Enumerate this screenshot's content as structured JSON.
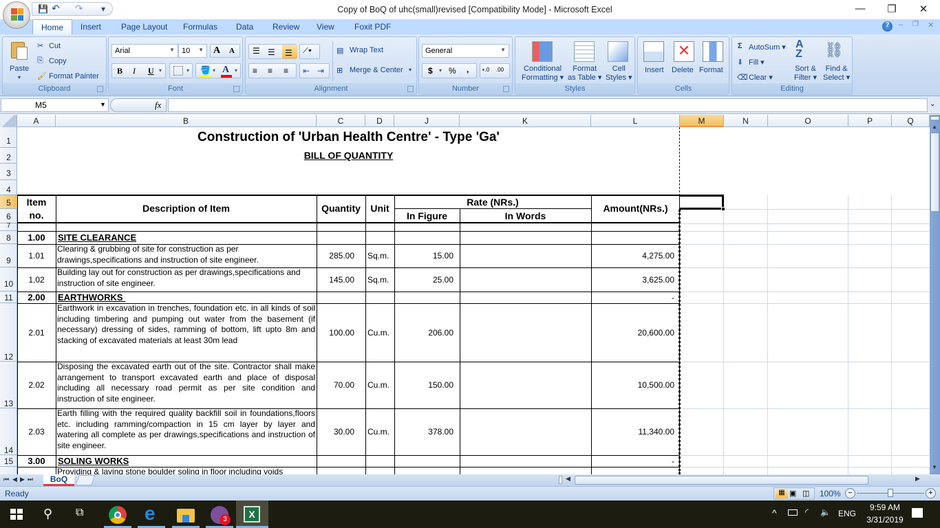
{
  "window": {
    "title": "Copy of BoQ of uhc(small)revised  [Compatibility Mode] - Microsoft Excel",
    "minimize": "—",
    "restore": "❐",
    "close": "✕"
  },
  "qat": {
    "save": "💾",
    "undo": "↶",
    "redo": "↷",
    "customize": "▾"
  },
  "tabs": [
    "Home",
    "Insert",
    "Page Layout",
    "Formulas",
    "Data",
    "Review",
    "View",
    "Foxit PDF"
  ],
  "active_tab": "Home",
  "ribbon": {
    "clipboard": {
      "label": "Clipboard",
      "paste": "Paste",
      "cut": "Cut",
      "copy": "Copy",
      "format_painter": "Format Painter"
    },
    "font": {
      "label": "Font",
      "font_name": "Arial",
      "font_size": "10",
      "bold": "B",
      "italic": "I",
      "underline": "U",
      "grow": "A",
      "shrink": "A",
      "font_color": "A",
      "fill_color_hex": "#ffff00",
      "font_color_hex": "#ff0000"
    },
    "alignment": {
      "label": "Alignment",
      "wrap_text": "Wrap Text",
      "merge_center": "Merge & Center"
    },
    "number": {
      "label": "Number",
      "format": "General",
      "currency": "$",
      "percent": "%",
      "comma": ",",
      "inc_decimal": "+.0",
      "dec_decimal": ".00"
    },
    "styles": {
      "label": "Styles",
      "conditional": "Conditional",
      "conditional2": "Formatting ▾",
      "format_table": "Format",
      "format_table2": "as Table ▾",
      "cell_styles": "Cell",
      "cell_styles2": "Styles ▾"
    },
    "cells": {
      "label": "Cells",
      "insert": "Insert",
      "delete": "Delete",
      "format": "Format"
    },
    "editing": {
      "label": "Editing",
      "autosum": "AutoSum ▾",
      "fill": "Fill ▾",
      "clear": "Clear ▾",
      "sort": "Sort &",
      "sort2": "Filter ▾",
      "find": "Find &",
      "find2": "Select ▾"
    }
  },
  "formula_bar": {
    "name_box": "M5",
    "fx": "fx",
    "formula": ""
  },
  "columns": [
    "A",
    "B",
    "C",
    "D",
    "J",
    "K",
    "L",
    "M",
    "N",
    "O",
    "P",
    "Q"
  ],
  "selected_column": "M",
  "rows": [
    "1",
    "2",
    "3",
    "4",
    "5",
    "6",
    "7",
    "8",
    "9",
    "10",
    "11",
    "12",
    "13",
    "14",
    "15"
  ],
  "selected_row": "5",
  "sheet": {
    "title": "Construction of 'Urban Health Centre' - Type 'Ga'",
    "subtitle": "BILL OF QUANTITY",
    "headers": {
      "item_no_1": "Item",
      "item_no_2": "no.",
      "description": "Description of  Item",
      "quantity": "Quantity",
      "unit": "Unit",
      "rate": "Rate (NRs.)",
      "in_figure": "In Figure",
      "in_words": "In Words",
      "amount": "Amount(NRs.)"
    },
    "items": [
      {
        "no": "1.00",
        "desc": "SITE CLEARANCE",
        "section": true,
        "qty": "",
        "unit": "",
        "rate": "",
        "amount": ""
      },
      {
        "no": "1.01",
        "desc": "Clearing & grubbing of site for construction as per drawings,specifications and instruction of site engineer.",
        "section": false,
        "qty": "285.00",
        "unit": "Sq.m.",
        "rate": "15.00",
        "amount": "4,275.00"
      },
      {
        "no": "1.02",
        "desc": "Building lay out for construction as per drawings,specifications and instruction of site engineer.",
        "section": false,
        "qty": "145.00",
        "unit": "Sq.m.",
        "rate": "25.00",
        "amount": "3,625.00"
      },
      {
        "no": "2.00",
        "desc": "EARTHWORKS ",
        "section": true,
        "qty": "",
        "unit": "",
        "rate": "",
        "amount": "-"
      },
      {
        "no": "2.01",
        "desc": "Earthwork in excavation in trenches, foundation etc. in all kinds of soil including timbering and pumping out water from the basement (if necessary) dressing of sides, ramming of bottom, lift upto 8m and stacking of excavated materials at least 30m lead",
        "section": false,
        "qty": "100.00",
        "unit": "Cu.m.",
        "rate": "206.00",
        "amount": "20,600.00"
      },
      {
        "no": "2.02",
        "desc": "Disposing the excavated earth out of the site. Contractor shall make arrangement  to transport  excavated earth and place of disposal including all necessary road permit as per site condition and instruction of site engineer.",
        "section": false,
        "qty": "70.00",
        "unit": "Cu.m.",
        "rate": "150.00",
        "amount": "10,500.00"
      },
      {
        "no": "2.03",
        "desc": "Earth filling with the required quality backfill soil in foundations,floors etc. including ramming/compaction in 15 cm layer by layer and watering all complete as per drawings,specifications and instruction of site engineer.",
        "section": false,
        "qty": "30.00",
        "unit": "Cu.m.",
        "rate": "378.00",
        "amount": "11,340.00"
      },
      {
        "no": "3.00",
        "desc": "SOLING WORKS",
        "section": true,
        "qty": "",
        "unit": "",
        "rate": "",
        "amount": "-"
      },
      {
        "no": "",
        "desc": "Providing & laying stone boulder soling in  floor including voids",
        "section": false,
        "qty": "",
        "unit": "",
        "rate": "",
        "amount": ""
      }
    ]
  },
  "sheet_tabs": {
    "active": "BoQ",
    "nav": [
      "⏮",
      "◀",
      "▶",
      "⏭"
    ]
  },
  "status": {
    "mode": "Ready",
    "zoom": "100%",
    "zoom_level_percent": 100
  },
  "taskbar": {
    "time": "9:59 AM",
    "date": "3/31/2019",
    "lang": "ENG",
    "viber_badge": "3"
  }
}
